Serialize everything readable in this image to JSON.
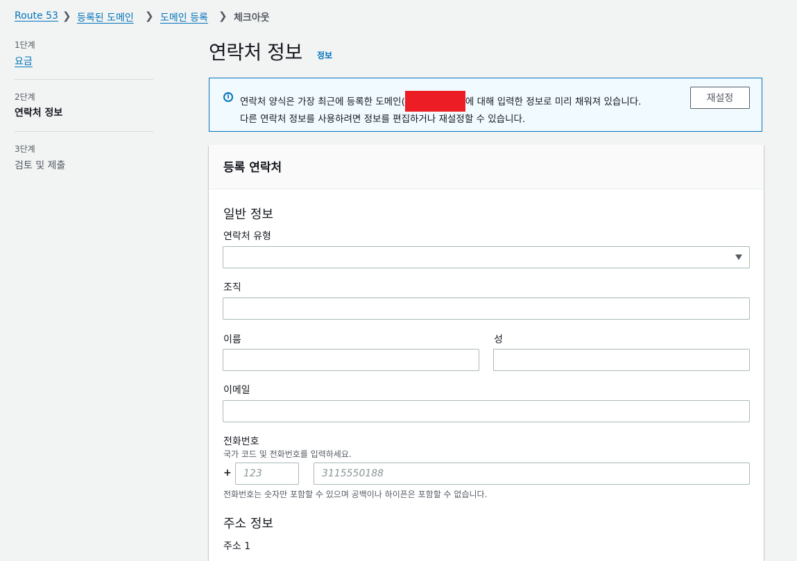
{
  "breadcrumb": {
    "items": [
      "Route 53",
      "등록된 도메인",
      "도메인 등록"
    ],
    "current": "체크아웃"
  },
  "steps": [
    {
      "label": "1단계",
      "text": "요금"
    },
    {
      "label": "2단계",
      "text": "연락처 정보"
    },
    {
      "label": "3단계",
      "text": "검토 및 제출"
    }
  ],
  "page": {
    "title": "연락처 정보",
    "info_link": "정보"
  },
  "alert": {
    "line1_before": "연락처 양식은 가장 최근에 등록한 도메인(",
    "line1_after": "에 대해 입력한 정보로 미리 채워져 있습니다.",
    "line2": "다른 연락처 정보를 사용하려면 정보를 편집하거나 재설정할 수 있습니다.",
    "reset_button": "재설정"
  },
  "panel": {
    "title": "등록 연락처",
    "general_section": "일반 정보",
    "contact_type_label": "연락처 유형",
    "contact_type_value": "",
    "organization_label": "조직",
    "first_name_label": "이름",
    "last_name_label": "성",
    "email_label": "이메일",
    "phone_label": "전화번호",
    "phone_desc": "국가 코드 및 전화번호를 입력하세요.",
    "phone_plus": "+",
    "country_code_placeholder": "123",
    "phone_placeholder": "3115550188",
    "phone_hint": "전화번호는 숫자만 포함할 수 있으며 공백이나 하이픈은 포함할 수 없습니다.",
    "address_section": "주소 정보",
    "address1_label": "주소 1"
  }
}
